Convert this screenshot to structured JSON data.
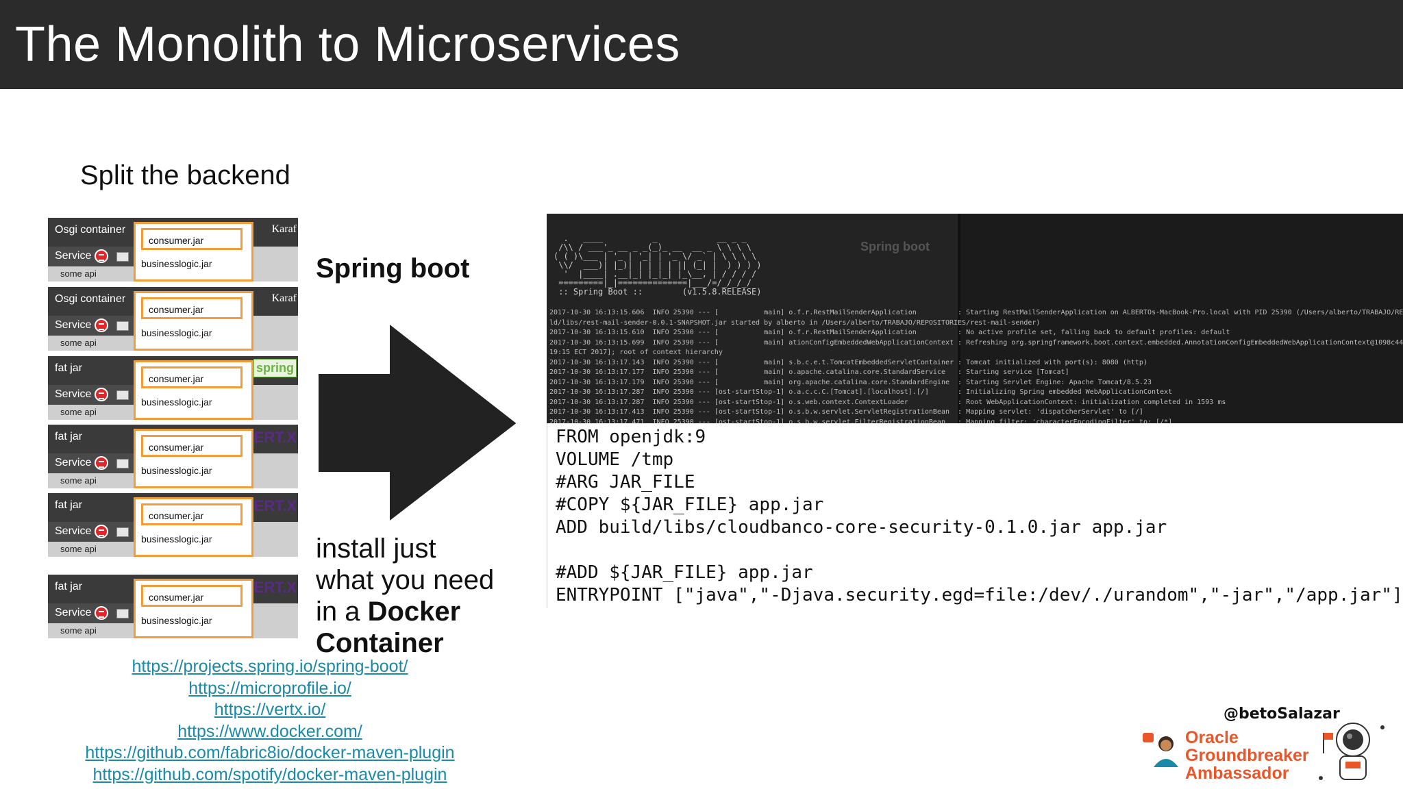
{
  "header": {
    "title": "The Monolith to Microservices"
  },
  "subtitle": "Split the backend",
  "containers": [
    {
      "type": "Osgi container",
      "service": "Service",
      "api": "some api",
      "jar1": "consumer.jar",
      "jar2": "businesslogic.jar",
      "logo": "Karaf"
    },
    {
      "type": "Osgi container",
      "service": "Service",
      "api": "some api",
      "jar1": "consumer.jar",
      "jar2": "businesslogic.jar",
      "logo": "Karaf"
    },
    {
      "type": "fat jar",
      "service": "Service",
      "api": "some api",
      "jar1": "consumer.jar",
      "jar2": "businesslogic.jar",
      "logo": "spring"
    },
    {
      "type": "fat jar",
      "service": "Service",
      "api": "some api",
      "jar1": "consumer.jar",
      "jar2": "businesslogic.jar",
      "logo": "VERT.X"
    },
    {
      "type": "fat jar",
      "service": "Service",
      "api": "some api",
      "jar1": "consumer.jar",
      "jar2": "businesslogic.jar",
      "logo": "VERT.X"
    },
    {
      "type": "fat jar",
      "service": "Service",
      "api": "some api",
      "jar1": "consumer.jar",
      "jar2": "businesslogic.jar",
      "logo": "VERT.X"
    }
  ],
  "spring_boot_label": "Spring boot",
  "install": {
    "line1": "install just",
    "line2": "what you need",
    "line3a": "in a ",
    "line3b": "Docker",
    "line4": "Container"
  },
  "links": [
    "https://projects.spring.io/spring-boot/",
    "https://microprofile.io/",
    "https://vertx.io/",
    "https://www.docker.com/",
    "https://github.com/fabric8io/docker-maven-plugin",
    "https://github.com/spotify/docker-maven-plugin"
  ],
  "terminal": {
    "ascii": "  .   ____          _            __ _ _\n /\\\\ / ___'_ __ _ _(_)_ __  __ _ \\ \\ \\ \\\n( ( )\\___ | '_ | '_| | '_ \\/ _` | \\ \\ \\ \\\n \\\\/  ___)| |_)| | | | | || (_| |  ) ) ) )\n  '  |____| .__|_| |_|_| |_\\__, | / / / /\n =========|_|==============|___/=/_/_/_/\n :: Spring Boot ::        (v1.5.8.RELEASE)",
    "ghost_label": "Spring boot",
    "log": "2017-10-30 16:13:15.606  INFO 25390 --- [           main] o.f.r.RestMailSenderApplication          : Starting RestMailSenderApplication on ALBERTOs-MacBook-Pro.local with PID 25390 (/Users/alberto/TRABAJO/REPOSITORIES\nld/libs/rest-mail-sender-0.0.1-SNAPSHOT.jar started by alberto in /Users/alberto/TRABAJO/REPOSITORIES/rest-mail-sender)\n2017-10-30 16:13:15.610  INFO 25390 --- [           main] o.f.r.RestMailSenderApplication          : No active profile set, falling back to default profiles: default\n2017-10-30 16:13:15.699  INFO 25390 --- [           main] ationConfigEmbeddedWebApplicationContext : Refreshing org.springframework.boot.context.embedded.AnnotationConfigEmbeddedWebApplicationContext@1098c449\n19:15 ECT 2017]; root of context hierarchy\n2017-10-30 16:13:17.143  INFO 25390 --- [           main] s.b.c.e.t.TomcatEmbeddedServletContainer : Tomcat initialized with port(s): 8080 (http)\n2017-10-30 16:13:17.177  INFO 25390 --- [           main] o.apache.catalina.core.StandardService   : Starting service [Tomcat]\n2017-10-30 16:13:17.179  INFO 25390 --- [           main] org.apache.catalina.core.StandardEngine  : Starting Servlet Engine: Apache Tomcat/8.5.23\n2017-10-30 16:13:17.287  INFO 25390 --- [ost-startStop-1] o.a.c.c.C.[Tomcat].[localhost].[/]       : Initializing Spring embedded WebApplicationContext\n2017-10-30 16:13:17.287  INFO 25390 --- [ost-startStop-1] o.s.web.context.ContextLoader            : Root WebApplicationContext: initialization completed in 1593 ms\n2017-10-30 16:13:17.413  INFO 25390 --- [ost-startStop-1] o.s.b.w.servlet.ServletRegistrationBean  : Mapping servlet: 'dispatcherServlet' to [/]\n2017-10-30 16:13:17.471  INFO 25390 --- [ost-startStop-1] o.s.b.w.servlet.FilterRegistrationBean   : Mapping filter: 'characterEncodingFilter' to: [/*]"
  },
  "dockerfile": "FROM openjdk:9\nVOLUME /tmp\n#ARG JAR_FILE\n#COPY ${JAR_FILE} app.jar\nADD build/libs/cloudbanco-core-security-0.1.0.jar app.jar\n\n#ADD ${JAR_FILE} app.jar\nENTRYPOINT [\"java\",\"-Djava.security.egd=file:/dev/./urandom\",\"-jar\",\"/app.jar\"]",
  "footer": {
    "handle": "@betoSalazar",
    "badge_line1": "Oracle",
    "badge_line2": "Groundbreaker",
    "badge_line3": "Ambassador"
  },
  "colors": {
    "header_bg": "#2b2b2b",
    "jar_border": "#f29d38",
    "link": "#1a8aa8",
    "oracle": "#e8562a"
  }
}
